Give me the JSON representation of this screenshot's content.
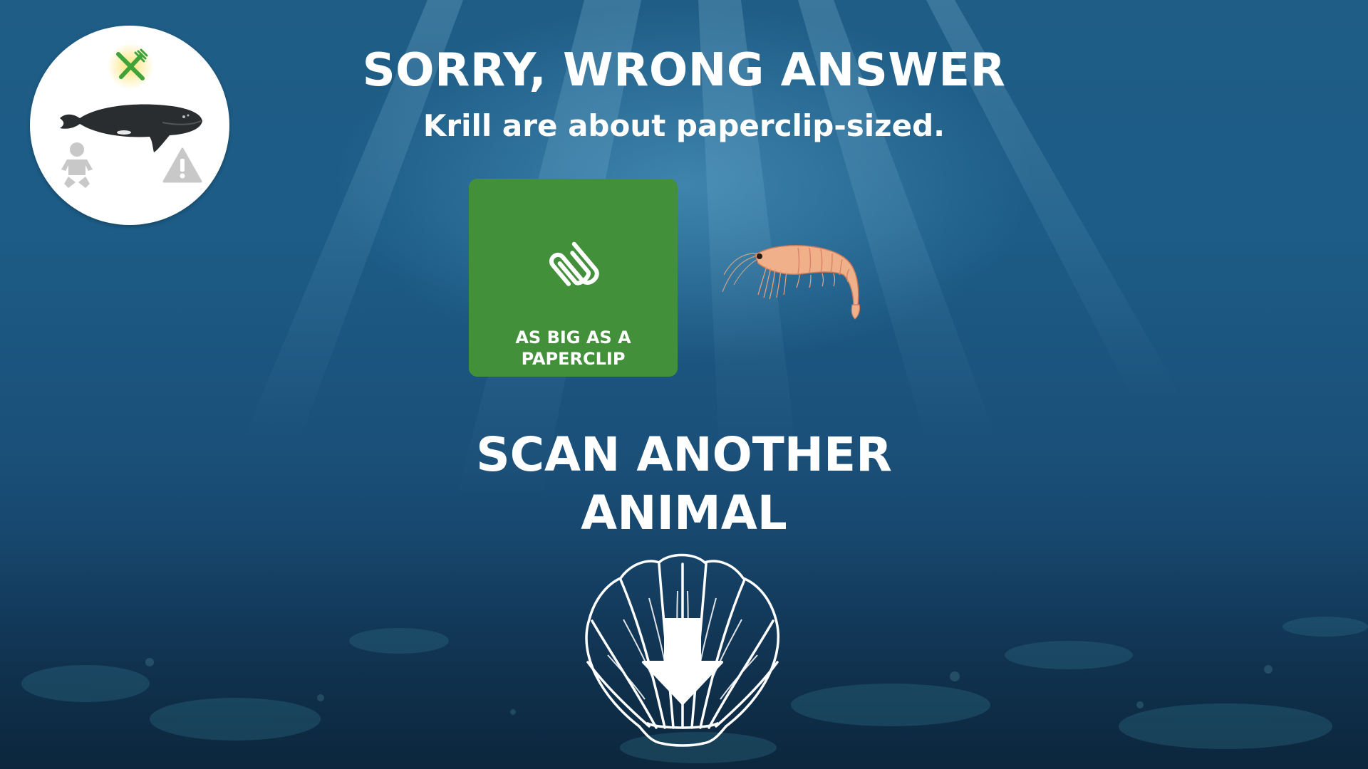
{
  "header": {
    "title": "SORRY, WRONG ANSWER",
    "subtitle": "Krill are about paperclip-sized."
  },
  "status_badge": {
    "icons": [
      "food-icon",
      "whale-image",
      "baby-icon",
      "warning-icon"
    ],
    "active_icon": "food-icon",
    "active_color": "#3fa33a",
    "inactive_color": "#c8c8c8"
  },
  "answer_card": {
    "label": "AS BIG AS A\nPAPERCLIP",
    "icon": "paperclip-icon",
    "color": "#43903a"
  },
  "subject_image": "krill-image",
  "scan_prompt": {
    "label": "SCAN ANOTHER\nANIMAL",
    "icon": "scan-shell-arrow-icon"
  },
  "colors": {
    "background": "#1c5c86",
    "text": "#ffffff"
  }
}
